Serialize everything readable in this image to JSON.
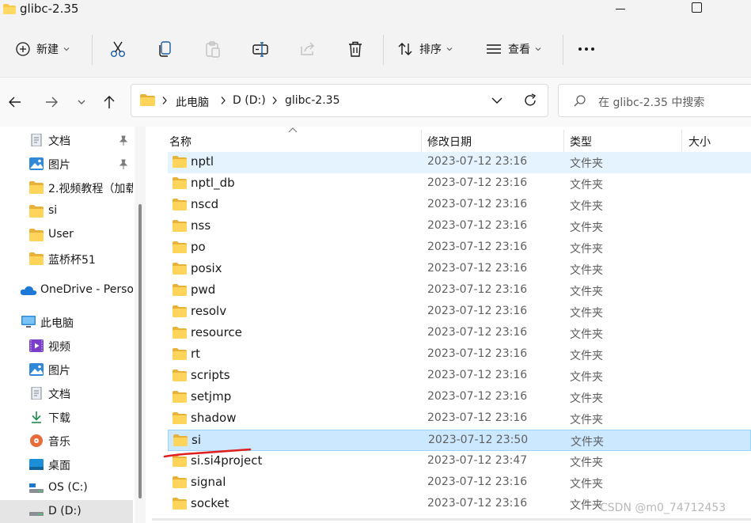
{
  "window": {
    "title": "glibc-2.35"
  },
  "toolbar": {
    "new_label": "新建",
    "sort_label": "排序",
    "view_label": "查看",
    "more_label": "..."
  },
  "address": {
    "crumbs": [
      "此电脑",
      "D (D:)",
      "glibc-2.35"
    ],
    "search_placeholder": "在 glibc-2.35 中搜索"
  },
  "sidebar": {
    "items": [
      {
        "label": "文档",
        "icon": "document-icon",
        "pinned": true
      },
      {
        "label": "图片",
        "icon": "pictures-icon",
        "pinned": true
      },
      {
        "label": "2.视频教程（加载",
        "icon": "folder-icon",
        "pinned": false
      },
      {
        "label": "si",
        "icon": "folder-icon",
        "pinned": false
      },
      {
        "label": "User",
        "icon": "folder-icon",
        "pinned": false
      },
      {
        "label": "蓝桥杯51",
        "icon": "folder-icon",
        "pinned": false
      },
      {
        "label": "OneDrive - Perso",
        "icon": "onedrive-icon",
        "pinned": false
      },
      {
        "label": "此电脑",
        "icon": "this-pc-icon",
        "pinned": false
      },
      {
        "label": "视频",
        "icon": "videos-icon",
        "pinned": false
      },
      {
        "label": "图片",
        "icon": "pictures-icon",
        "pinned": false
      },
      {
        "label": "文档",
        "icon": "document-icon",
        "pinned": false
      },
      {
        "label": "下载",
        "icon": "download-icon",
        "pinned": false
      },
      {
        "label": "音乐",
        "icon": "music-icon",
        "pinned": false
      },
      {
        "label": "桌面",
        "icon": "desktop-icon",
        "pinned": false
      },
      {
        "label": "OS (C:)",
        "icon": "drive-c-icon",
        "pinned": false
      },
      {
        "label": "D (D:)",
        "icon": "drive-d-icon",
        "pinned": false
      }
    ]
  },
  "filelist": {
    "columns": {
      "name": "名称",
      "modified": "修改日期",
      "type": "类型",
      "size": "大小"
    },
    "rows": [
      {
        "name": "nptl",
        "modified": "2023-07-12 23:16",
        "type": "文件夹"
      },
      {
        "name": "nptl_db",
        "modified": "2023-07-12 23:16",
        "type": "文件夹"
      },
      {
        "name": "nscd",
        "modified": "2023-07-12 23:16",
        "type": "文件夹"
      },
      {
        "name": "nss",
        "modified": "2023-07-12 23:16",
        "type": "文件夹"
      },
      {
        "name": "po",
        "modified": "2023-07-12 23:16",
        "type": "文件夹"
      },
      {
        "name": "posix",
        "modified": "2023-07-12 23:16",
        "type": "文件夹"
      },
      {
        "name": "pwd",
        "modified": "2023-07-12 23:16",
        "type": "文件夹"
      },
      {
        "name": "resolv",
        "modified": "2023-07-12 23:16",
        "type": "文件夹"
      },
      {
        "name": "resource",
        "modified": "2023-07-12 23:16",
        "type": "文件夹"
      },
      {
        "name": "rt",
        "modified": "2023-07-12 23:16",
        "type": "文件夹"
      },
      {
        "name": "scripts",
        "modified": "2023-07-12 23:16",
        "type": "文件夹"
      },
      {
        "name": "setjmp",
        "modified": "2023-07-12 23:16",
        "type": "文件夹"
      },
      {
        "name": "shadow",
        "modified": "2023-07-12 23:16",
        "type": "文件夹"
      },
      {
        "name": "si",
        "modified": "2023-07-12 23:50",
        "type": "文件夹",
        "selected": true
      },
      {
        "name": "si.si4project",
        "modified": "2023-07-12 23:47",
        "type": "文件夹"
      },
      {
        "name": "signal",
        "modified": "2023-07-12 23:16",
        "type": "文件夹"
      },
      {
        "name": "socket",
        "modified": "2023-07-12 23:16",
        "type": "文件夹"
      }
    ]
  },
  "watermark": "CSDN @m0_74712453",
  "colors": {
    "folder": "#f8c94a",
    "selected_row": "#cce8ff",
    "hover_row": "#e5f3ff",
    "annotation": "#e02020"
  }
}
